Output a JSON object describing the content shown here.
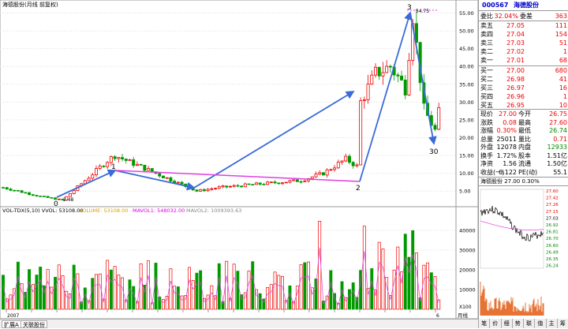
{
  "chart_title": "海德股份(月线 前复权)",
  "kline": {
    "annotations": [
      "0",
      "1",
      "2",
      "3",
      "30"
    ],
    "high_label": "54.75",
    "low_label": "2.48",
    "y_ticks": [
      "55.00",
      "50.00",
      "45.00",
      "40.00",
      "35.00",
      "30.00",
      "25.00",
      "20.00",
      "15.00",
      "10.00",
      "5.00"
    ]
  },
  "volume": {
    "header": "VOL-TDX(5,10)  VVOL: 53108.00",
    "legend": [
      "VOLUME: 53108.00",
      "MAVOL1: 548032.00",
      "MAVOL2: 1009393.63"
    ],
    "y_ticks": [
      "40000",
      "30000",
      "20000",
      "10000"
    ],
    "unit": "X100"
  },
  "x_labels": [
    "2007",
    "",
    "",
    "",
    "",
    "",
    "",
    "",
    "",
    "",
    "",
    "",
    "",
    "",
    "",
    "",
    "",
    "6"
  ],
  "period_label": "月线",
  "stock": {
    "code": "000567",
    "name": "海德股份"
  },
  "quote": {
    "ratio_label": "委比",
    "ratio": "32.04%",
    "diff_label": "委差",
    "diff": "363",
    "sell": [
      {
        "label": "卖五",
        "price": "27.05",
        "vol": "111"
      },
      {
        "label": "卖四",
        "price": "27.04",
        "vol": "154"
      },
      {
        "label": "卖三",
        "price": "27.03",
        "vol": "51"
      },
      {
        "label": "卖二",
        "price": "27.02",
        "vol": "1"
      },
      {
        "label": "卖一",
        "price": "27.01",
        "vol": "68"
      }
    ],
    "buy": [
      {
        "label": "买一",
        "price": "27.00",
        "vol": "680"
      },
      {
        "label": "买二",
        "price": "26.98",
        "vol": "41"
      },
      {
        "label": "买三",
        "price": "26.97",
        "vol": "16"
      },
      {
        "label": "买四",
        "price": "26.96",
        "vol": "1"
      },
      {
        "label": "买五",
        "price": "26.95",
        "vol": "10"
      }
    ],
    "stats": [
      {
        "l1": "现价",
        "v1": "27.00",
        "l2": "今开",
        "v2": "26.75"
      },
      {
        "l1": "涨跌",
        "v1": "0.08",
        "l2": "最高",
        "v2": "27.60"
      },
      {
        "l1": "涨幅",
        "v1": "0.30%",
        "l2": "最低",
        "v2": "26.74"
      },
      {
        "l1": "总量",
        "v1": "25011",
        "l2": "量比",
        "v2": "0.71"
      },
      {
        "l1": "外盘",
        "v1": "12078",
        "l2": "内盘",
        "v2": "12933"
      },
      {
        "l1": "换手",
        "v1": "1.72%",
        "l2": "股本",
        "v2": "1.51亿"
      },
      {
        "l1": "净资",
        "v1": "1.56",
        "l2": "流通",
        "v2": "1.50亿"
      },
      {
        "l1": "收益(一)",
        "v1": "0.122",
        "l2": "PE(动)",
        "v2": "55.1"
      }
    ]
  },
  "mini": {
    "title": "海德股份  27.00  0.30%",
    "y_ticks": [
      "27.60",
      "27.42",
      "27.26",
      "27.15",
      "27.03",
      "26.92",
      "26.81",
      "26.70",
      "26.60",
      "26.49",
      "26.35",
      "26.24"
    ]
  },
  "bottom_tabs": [
    "扩展A",
    "关联股份"
  ],
  "right_tabs": [
    "笔",
    "价",
    "细",
    "势",
    "联",
    "值",
    "主",
    "筹"
  ]
}
